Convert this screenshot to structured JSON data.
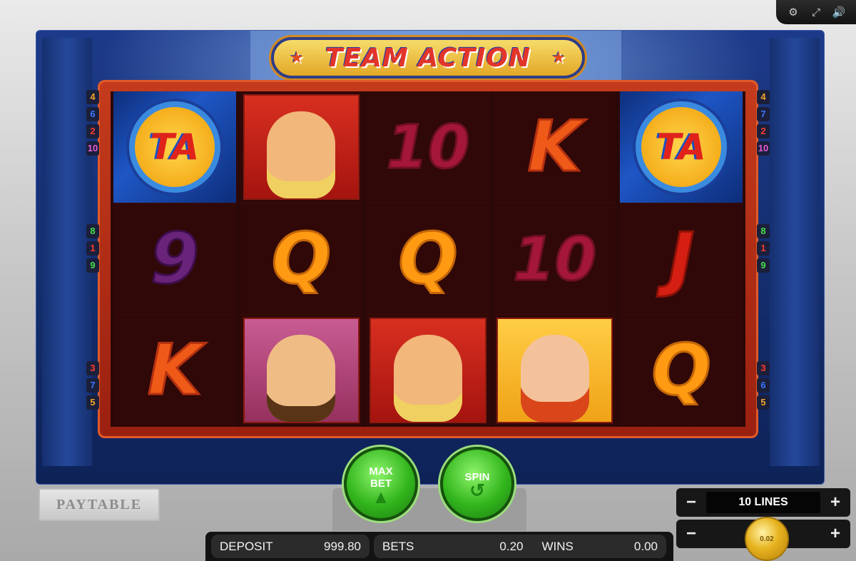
{
  "game": {
    "logo_text": "TEAM ACTION"
  },
  "topbar": {
    "icons": [
      "gear-icon",
      "fullscreen-icon",
      "sound-icon"
    ]
  },
  "reels": [
    [
      "WILD",
      "9",
      "K"
    ],
    [
      "BLOND",
      "Q",
      "GOGGLES"
    ],
    [
      "10",
      "Q",
      "BLOND"
    ],
    [
      "K",
      "10",
      "REDHEAD"
    ],
    [
      "WILD",
      "J",
      "Q"
    ]
  ],
  "wild_text": "TA",
  "lines_left": [
    {
      "n": "4",
      "color": "#f2a62a"
    },
    {
      "n": "6",
      "color": "#3a76ff"
    },
    {
      "n": "2",
      "color": "#ff3b30"
    },
    {
      "n": "10",
      "color": "#e85ad8"
    },
    {
      "n": "8",
      "color": "#46e04a"
    },
    {
      "n": "1",
      "color": "#ff3b30"
    },
    {
      "n": "9",
      "color": "#46e04a"
    },
    {
      "n": "3",
      "color": "#ff3b30"
    },
    {
      "n": "7",
      "color": "#3a76ff"
    },
    {
      "n": "5",
      "color": "#f2a62a"
    }
  ],
  "lines_right": [
    {
      "n": "4",
      "color": "#f2a62a"
    },
    {
      "n": "7",
      "color": "#3a76ff"
    },
    {
      "n": "2",
      "color": "#ff3b30"
    },
    {
      "n": "10",
      "color": "#e85ad8"
    },
    {
      "n": "8",
      "color": "#46e04a"
    },
    {
      "n": "1",
      "color": "#ff3b30"
    },
    {
      "n": "9",
      "color": "#46e04a"
    },
    {
      "n": "3",
      "color": "#ff3b30"
    },
    {
      "n": "6",
      "color": "#3a76ff"
    },
    {
      "n": "5",
      "color": "#f2a62a"
    }
  ],
  "controls": {
    "paytable": "PAYTABLE",
    "maxbet_line1": "MAX",
    "maxbet_line2": "BET",
    "spin": "SPIN",
    "lines_label": "10 LINES",
    "minus": "−",
    "plus": "+",
    "coin_value": "0.02"
  },
  "status": {
    "deposit_label": "DEPOSIT",
    "deposit_value": "999.80",
    "bets_label": "BETS",
    "bets_value": "0.20",
    "wins_label": "WINS",
    "wins_value": "0.00"
  }
}
